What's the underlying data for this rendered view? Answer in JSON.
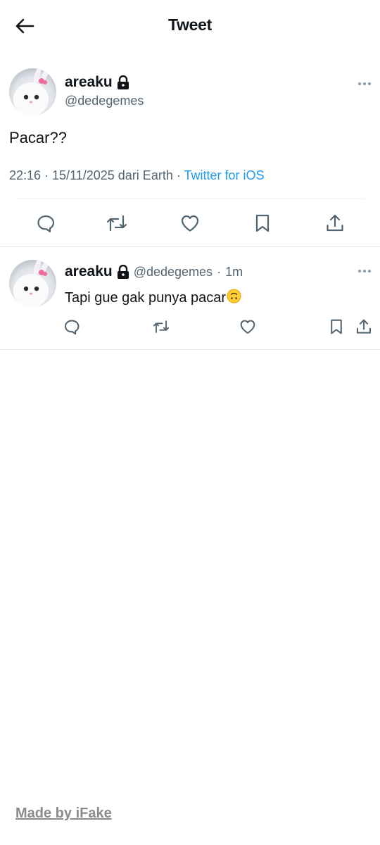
{
  "header": {
    "title": "Tweet",
    "back_icon": "arrow-left-icon"
  },
  "main_tweet": {
    "display_name": "areaku",
    "handle": "@dedegemes",
    "text": "Pacar??",
    "time": "22:16 · 15/11/2025 dari Earth · ",
    "client": "Twitter for iOS",
    "protected": true,
    "actions": [
      "reply-icon",
      "retweet-icon",
      "like-icon",
      "bookmark-icon",
      "share-icon"
    ]
  },
  "reply": {
    "display_name": "areaku",
    "handle": "@dedegemes",
    "separator": "·",
    "age": "1m",
    "text": "Tapi gue gak punya pacar",
    "emoji": "upside-down-face"
  },
  "footer": {
    "label": "Made by iFake"
  },
  "colors": {
    "link": "#1d9bf0",
    "secondary": "#536471",
    "text": "#0f1419",
    "footer": "#8b8b8b"
  }
}
